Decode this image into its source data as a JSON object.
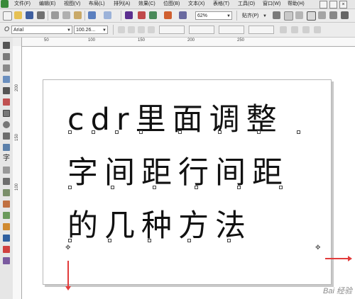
{
  "menubar": {
    "items": [
      "文件(F)",
      "编辑(E)",
      "视图(V)",
      "布局(L)",
      "排列(A)",
      "效果(C)",
      "位图(B)",
      "文本(X)",
      "表格(T)",
      "工具(O)",
      "窗口(W)",
      "帮助(H)"
    ]
  },
  "toolbar": {
    "zoom": "62%",
    "snap": "贴齐(P)"
  },
  "propertybar": {
    "font": "Arial",
    "font_size": "100.26..."
  },
  "ruler": {
    "h_ticks": [
      "50",
      "100",
      "150",
      "200",
      "250"
    ],
    "v_ticks": [
      "200",
      "150",
      "100"
    ]
  },
  "document": {
    "lines": [
      "cdr里面调整",
      "字间距行间距",
      "的几种方法"
    ]
  },
  "watermark": "Bai 经验",
  "accent": "#e23b3b"
}
